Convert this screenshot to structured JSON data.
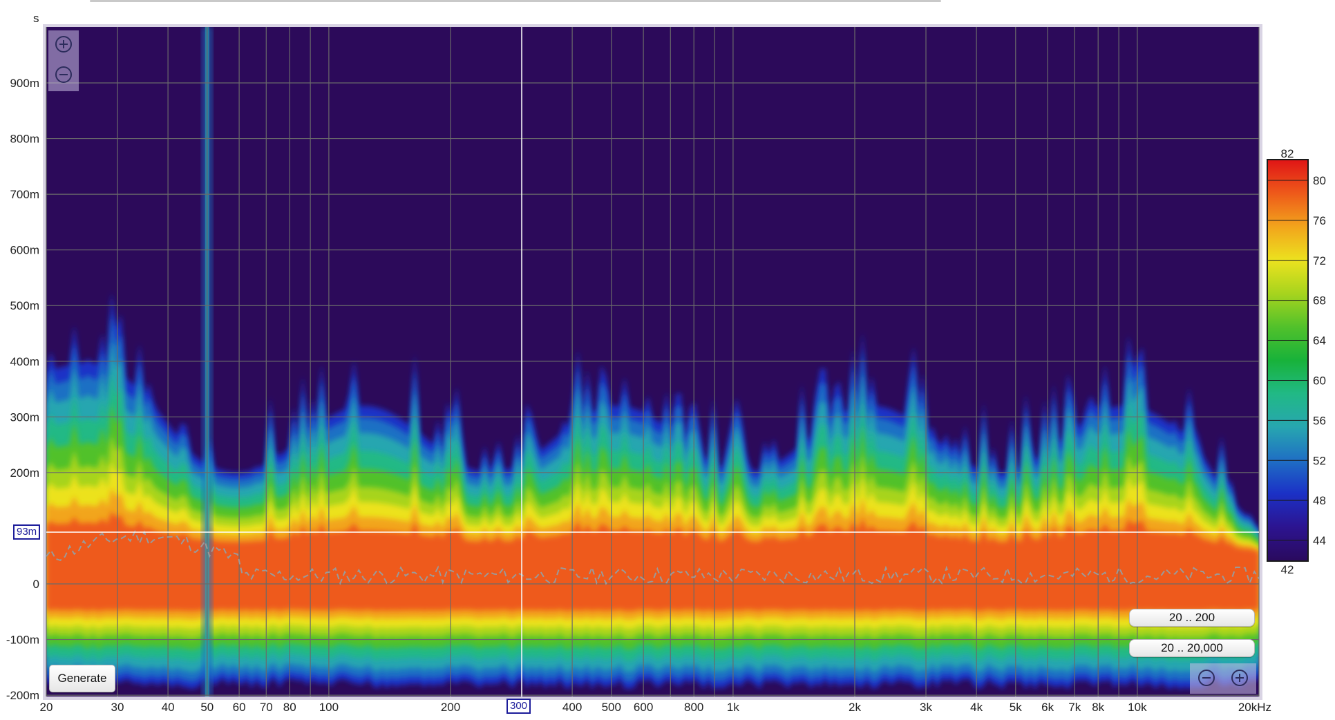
{
  "top_bar": {
    "note": ""
  },
  "y_axis": {
    "unit_label": "s",
    "ticks": [
      {
        "label": "900m",
        "value": 0.9
      },
      {
        "label": "800m",
        "value": 0.8
      },
      {
        "label": "700m",
        "value": 0.7
      },
      {
        "label": "600m",
        "value": 0.6
      },
      {
        "label": "500m",
        "value": 0.5
      },
      {
        "label": "400m",
        "value": 0.4
      },
      {
        "label": "300m",
        "value": 0.3
      },
      {
        "label": "200m",
        "value": 0.2
      },
      {
        "label": "-100m",
        "value": -0.1
      },
      {
        "label": "0",
        "value": 0.0
      },
      {
        "label": "-200m",
        "value": -0.2
      }
    ]
  },
  "x_axis": {
    "ticks": [
      {
        "label": "20",
        "value": 20
      },
      {
        "label": "30",
        "value": 30
      },
      {
        "label": "40",
        "value": 40
      },
      {
        "label": "50",
        "value": 50
      },
      {
        "label": "60",
        "value": 60
      },
      {
        "label": "70",
        "value": 70
      },
      {
        "label": "80",
        "value": 80
      },
      {
        "label": "100",
        "value": 100
      },
      {
        "label": "200",
        "value": 200
      },
      {
        "label": "400",
        "value": 400
      },
      {
        "label": "500",
        "value": 500
      },
      {
        "label": "600",
        "value": 600
      },
      {
        "label": "800",
        "value": 800
      },
      {
        "label": "1k",
        "value": 1000
      },
      {
        "label": "2k",
        "value": 2000
      },
      {
        "label": "3k",
        "value": 3000
      },
      {
        "label": "4k",
        "value": 4000
      },
      {
        "label": "5k",
        "value": 5000
      },
      {
        "label": "6k",
        "value": 6000
      },
      {
        "label": "7k",
        "value": 7000
      },
      {
        "label": "8k",
        "value": 8000
      },
      {
        "label": "10k",
        "value": 10000
      },
      {
        "label": "20kHz",
        "value": 20000
      }
    ]
  },
  "cursor": {
    "frequency_label": "300",
    "frequency_value": 300,
    "time_label": "93m",
    "time_value": 0.093
  },
  "colorbar": {
    "max_label": "82",
    "min_label": "42",
    "min": 42,
    "max": 82,
    "ticks": [
      {
        "label": "80",
        "value": 80
      },
      {
        "label": "76",
        "value": 76
      },
      {
        "label": "72",
        "value": 72
      },
      {
        "label": "68",
        "value": 68
      },
      {
        "label": "64",
        "value": 64
      },
      {
        "label": "60",
        "value": 60
      },
      {
        "label": "56",
        "value": 56
      },
      {
        "label": "52",
        "value": 52
      },
      {
        "label": "48",
        "value": 48
      },
      {
        "label": "44",
        "value": 44
      }
    ],
    "stops": [
      "#2a0a5e",
      "#2c1490",
      "#1b31c6",
      "#1f6fc4",
      "#27a6b0",
      "#21b985",
      "#18b23a",
      "#51c12b",
      "#a7d41e",
      "#ece21f",
      "#f2a51c",
      "#ee5a1a",
      "#e01616"
    ]
  },
  "buttons": {
    "generate": "Generate",
    "range_low": "20 .. 200",
    "range_full": "20 .. 20,000"
  },
  "icons": {
    "zoom_in": "zoom-in-icon",
    "zoom_out": "zoom-out-icon"
  },
  "plot": {
    "background": "#2c0a5a",
    "grid_color": "#6a6a6a"
  }
}
